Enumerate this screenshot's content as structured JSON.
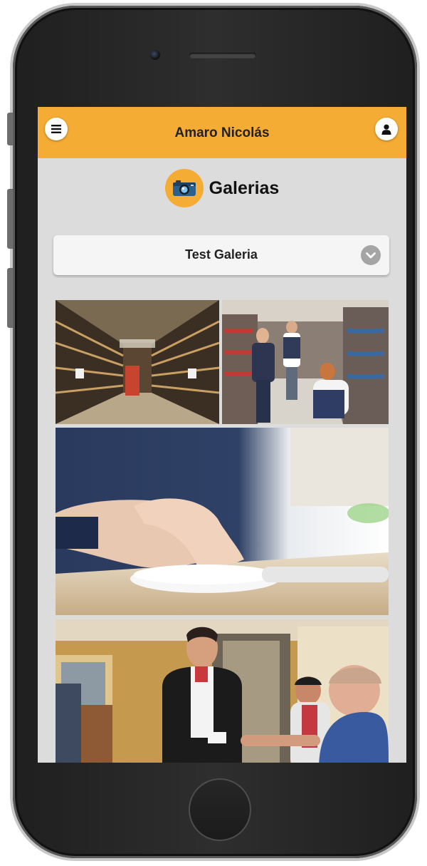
{
  "header": {
    "user_name": "Amaro Nicolás",
    "menu_icon": "hamburger-menu-icon",
    "profile_icon": "user-icon"
  },
  "section": {
    "title": "Galerias",
    "icon": "camera-icon"
  },
  "gallery_select": {
    "selected": "Test Galeria",
    "icon": "chevron-down-icon"
  },
  "photos": [
    {
      "subject": "warehouse aisle with shelves"
    },
    {
      "subject": "store employees stocking shelves"
    },
    {
      "subject": "hand using computer mouse"
    },
    {
      "subject": "people exchanging an ID card"
    }
  ],
  "colors": {
    "header": "#f5ac35",
    "screen_background": "#dcdcdc",
    "phone_frame": "#262626"
  }
}
